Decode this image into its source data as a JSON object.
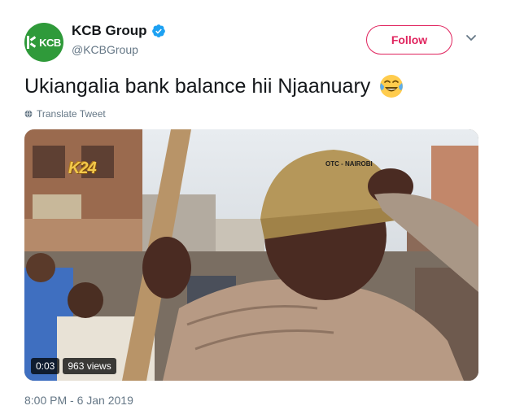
{
  "account": {
    "display_name": "KCB Group",
    "handle": "@KCBGroup",
    "avatar_text": "KCB",
    "verified": true
  },
  "actions": {
    "follow_label": "Follow",
    "menu_icon": "chevron-down-icon"
  },
  "tweet": {
    "text": "Ukiangalia bank balance hii Njaanuary",
    "emoji": "face-with-tears-of-joy",
    "translate_label": "Translate Tweet",
    "timestamp": "8:00 PM - 6 Jan 2019"
  },
  "video": {
    "channel_logo": "K24",
    "location_tag": "OTC - NAIROBI",
    "elapsed": "0:03",
    "views": "963 views"
  },
  "colors": {
    "accent": "#e0245e",
    "verified": "#1da1f2",
    "brand_green": "#2f9a3a",
    "secondary_text": "#657786"
  }
}
